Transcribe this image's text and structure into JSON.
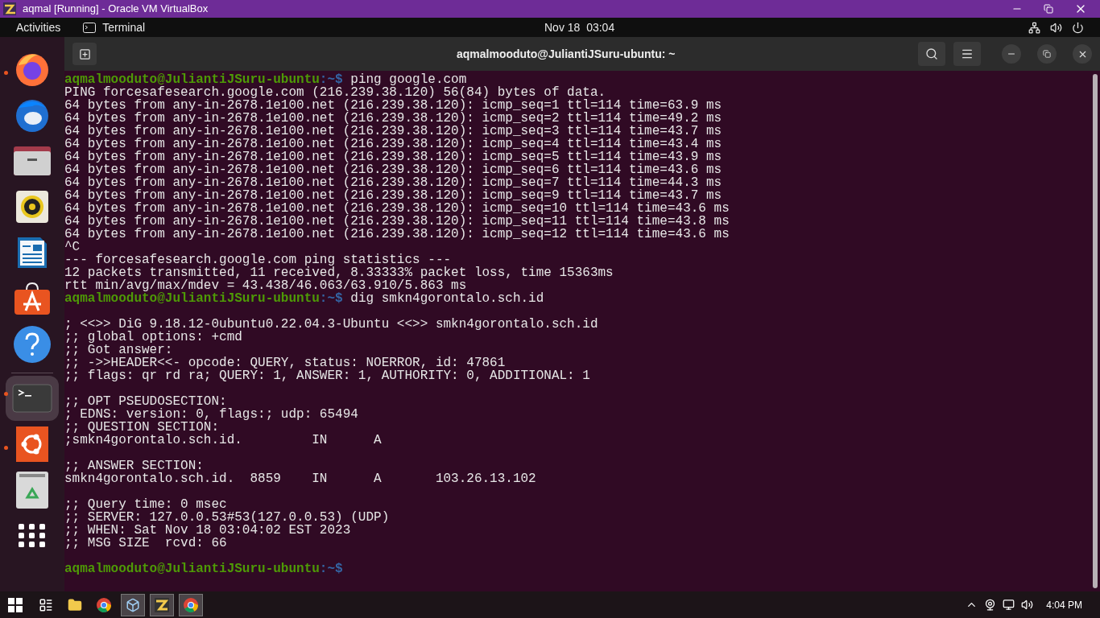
{
  "host_window": {
    "title": "aqmal [Running] - Oracle VM VirtualBox"
  },
  "top_bar": {
    "activities": "Activities",
    "app": "Terminal",
    "clock": "Nov 18  03:04"
  },
  "dock": {
    "items": [
      {
        "kind": "firefox",
        "running": true,
        "selected": false
      },
      {
        "kind": "thunderbird",
        "running": false,
        "selected": false
      },
      {
        "kind": "files",
        "running": false,
        "selected": false
      },
      {
        "kind": "rhythmbox",
        "running": false,
        "selected": false
      },
      {
        "kind": "writer",
        "running": false,
        "selected": false
      },
      {
        "kind": "appstore",
        "running": false,
        "selected": false
      },
      {
        "kind": "help",
        "running": false,
        "selected": false
      },
      {
        "kind": "terminal",
        "running": true,
        "selected": true
      },
      {
        "kind": "ubuntu",
        "running": true,
        "selected": false
      },
      {
        "kind": "trash",
        "running": false,
        "selected": false
      },
      {
        "kind": "apps",
        "running": false,
        "selected": false
      }
    ]
  },
  "terminal": {
    "title": "aqmalmooduto@JuliantiJSuru-ubuntu: ~",
    "lines": [
      {
        "kind": "prompt",
        "user": "aqmalmooduto@JuliantiJSuru-ubuntu",
        "path": ":~$",
        "command": " ping google.com"
      },
      {
        "kind": "output",
        "text": "PING forcesafesearch.google.com (216.239.38.120) 56(84) bytes of data."
      },
      {
        "kind": "output",
        "text": "64 bytes from any-in-2678.1e100.net (216.239.38.120): icmp_seq=1 ttl=114 time=63.9 ms"
      },
      {
        "kind": "output",
        "text": "64 bytes from any-in-2678.1e100.net (216.239.38.120): icmp_seq=2 ttl=114 time=49.2 ms"
      },
      {
        "kind": "output",
        "text": "64 bytes from any-in-2678.1e100.net (216.239.38.120): icmp_seq=3 ttl=114 time=43.7 ms"
      },
      {
        "kind": "output",
        "text": "64 bytes from any-in-2678.1e100.net (216.239.38.120): icmp_seq=4 ttl=114 time=43.4 ms"
      },
      {
        "kind": "output",
        "text": "64 bytes from any-in-2678.1e100.net (216.239.38.120): icmp_seq=5 ttl=114 time=43.9 ms"
      },
      {
        "kind": "output",
        "text": "64 bytes from any-in-2678.1e100.net (216.239.38.120): icmp_seq=6 ttl=114 time=43.6 ms"
      },
      {
        "kind": "output",
        "text": "64 bytes from any-in-2678.1e100.net (216.239.38.120): icmp_seq=7 ttl=114 time=44.3 ms"
      },
      {
        "kind": "output",
        "text": "64 bytes from any-in-2678.1e100.net (216.239.38.120): icmp_seq=9 ttl=114 time=43.7 ms"
      },
      {
        "kind": "output",
        "text": "64 bytes from any-in-2678.1e100.net (216.239.38.120): icmp_seq=10 ttl=114 time=43.6 ms"
      },
      {
        "kind": "output",
        "text": "64 bytes from any-in-2678.1e100.net (216.239.38.120): icmp_seq=11 ttl=114 time=43.8 ms"
      },
      {
        "kind": "output",
        "text": "64 bytes from any-in-2678.1e100.net (216.239.38.120): icmp_seq=12 ttl=114 time=43.6 ms"
      },
      {
        "kind": "output",
        "text": "^C"
      },
      {
        "kind": "output",
        "text": "--- forcesafesearch.google.com ping statistics ---"
      },
      {
        "kind": "output",
        "text": "12 packets transmitted, 11 received, 8.33333% packet loss, time 15363ms"
      },
      {
        "kind": "output",
        "text": "rtt min/avg/max/mdev = 43.438/46.063/63.910/5.863 ms"
      },
      {
        "kind": "prompt",
        "user": "aqmalmooduto@JuliantiJSuru-ubuntu",
        "path": ":~$",
        "command": " dig smkn4gorontalo.sch.id"
      },
      {
        "kind": "blank"
      },
      {
        "kind": "output",
        "text": "; <<>> DiG 9.18.12-0ubuntu0.22.04.3-Ubuntu <<>> smkn4gorontalo.sch.id"
      },
      {
        "kind": "output",
        "text": ";; global options: +cmd"
      },
      {
        "kind": "output",
        "text": ";; Got answer:"
      },
      {
        "kind": "output",
        "text": ";; ->>HEADER<<- opcode: QUERY, status: NOERROR, id: 47861"
      },
      {
        "kind": "output",
        "text": ";; flags: qr rd ra; QUERY: 1, ANSWER: 1, AUTHORITY: 0, ADDITIONAL: 1"
      },
      {
        "kind": "blank"
      },
      {
        "kind": "output",
        "text": ";; OPT PSEUDOSECTION:"
      },
      {
        "kind": "output",
        "text": "; EDNS: version: 0, flags:; udp: 65494"
      },
      {
        "kind": "output",
        "text": ";; QUESTION SECTION:"
      },
      {
        "kind": "output",
        "text": ";smkn4gorontalo.sch.id.         IN      A"
      },
      {
        "kind": "blank"
      },
      {
        "kind": "output",
        "text": ";; ANSWER SECTION:"
      },
      {
        "kind": "output",
        "text": "smkn4gorontalo.sch.id.  8859    IN      A       103.26.13.102"
      },
      {
        "kind": "blank"
      },
      {
        "kind": "output",
        "text": ";; Query time: 0 msec"
      },
      {
        "kind": "output",
        "text": ";; SERVER: 127.0.0.53#53(127.0.0.53) (UDP)"
      },
      {
        "kind": "output",
        "text": ";; WHEN: Sat Nov 18 03:04:02 EST 2023"
      },
      {
        "kind": "output",
        "text": ";; MSG SIZE  rcvd: 66"
      },
      {
        "kind": "blank"
      },
      {
        "kind": "prompt",
        "user": "aqmalmooduto@JuliantiJSuru-ubuntu",
        "path": ":~$"
      }
    ]
  },
  "taskbar": {
    "items": [
      {
        "kind": "start",
        "selected": false
      },
      {
        "kind": "taskview",
        "selected": false
      },
      {
        "kind": "explorer",
        "selected": false
      },
      {
        "kind": "chrome",
        "selected": false
      },
      {
        "kind": "virtualbox",
        "selected": true
      },
      {
        "kind": "vm",
        "selected": true
      },
      {
        "kind": "chrome",
        "selected": true
      }
    ],
    "clock": "4:04 PM"
  }
}
